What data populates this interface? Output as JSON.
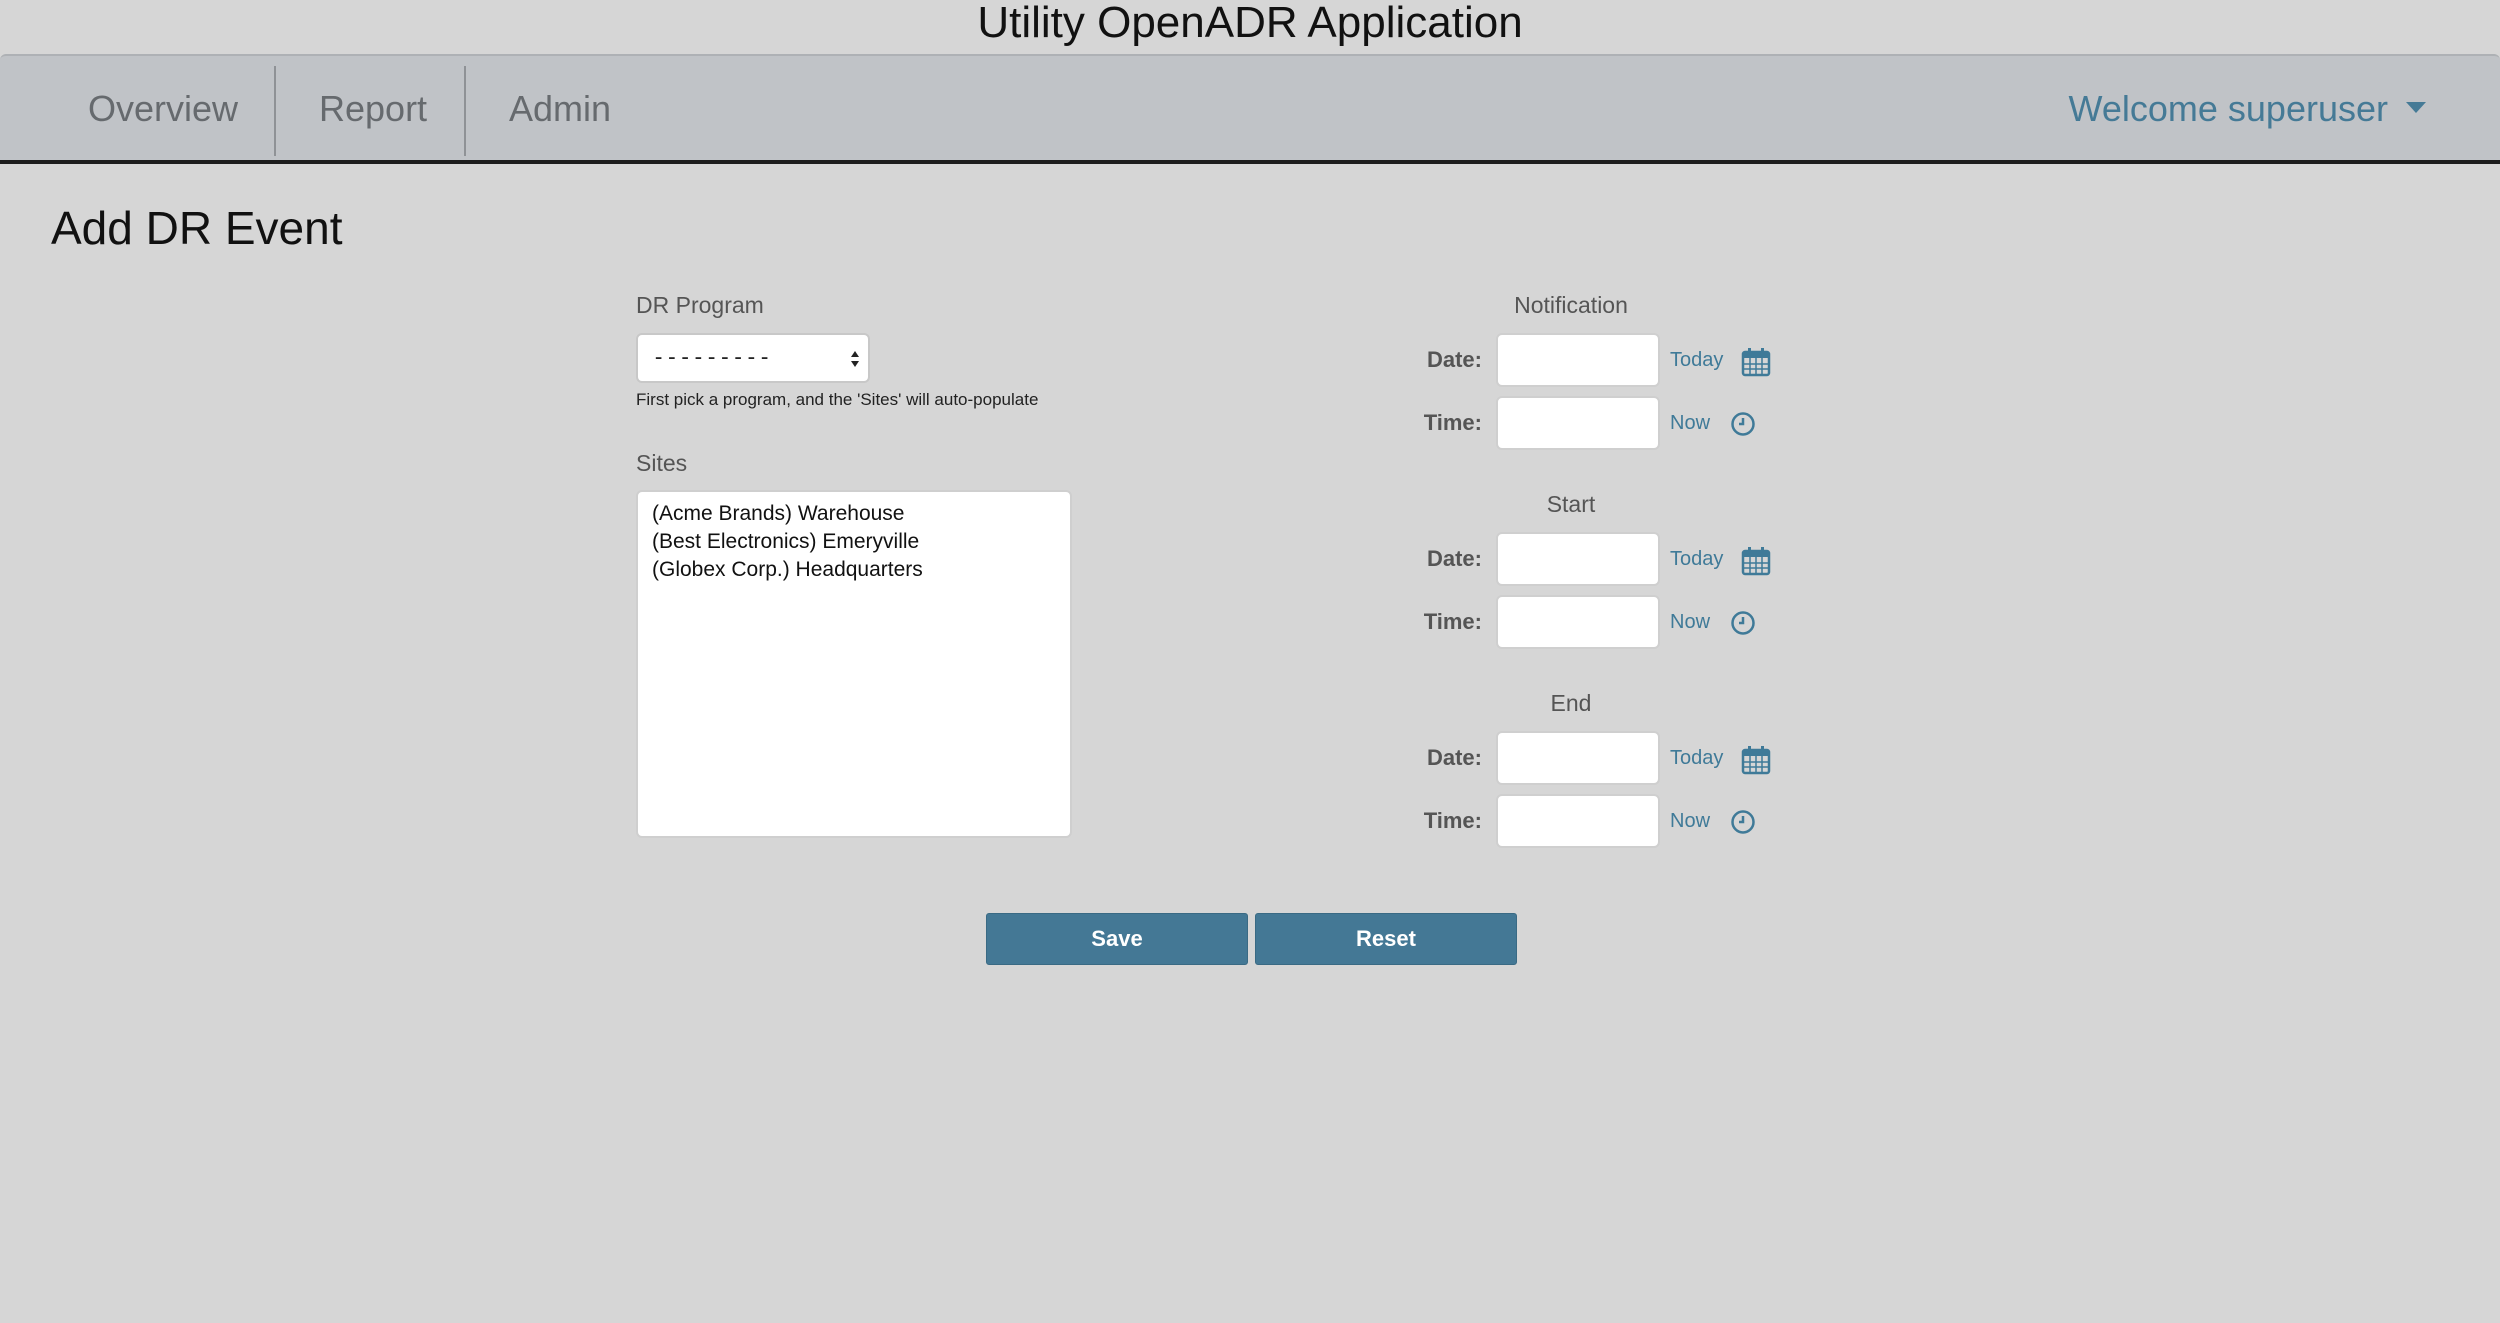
{
  "app": {
    "title": "Utility OpenADR Application"
  },
  "nav": {
    "items": [
      {
        "label": "Overview"
      },
      {
        "label": "Report"
      },
      {
        "label": "Admin"
      }
    ],
    "user_menu": "Welcome superuser"
  },
  "page": {
    "title": "Add DR Event"
  },
  "form": {
    "program_label": "DR Program",
    "program_value": "---------",
    "program_help": "First pick a program, and the 'Sites' will auto-populate",
    "sites_label": "Sites",
    "sites": [
      "(Acme Brands) Warehouse",
      "(Best Electronics) Emeryville",
      "(Globex Corp.) Headquarters"
    ],
    "schedule": [
      {
        "title": "Notification",
        "date_label": "Date:",
        "time_label": "Time:",
        "date_value": "",
        "time_value": "",
        "today_label": "Today",
        "now_label": "Now"
      },
      {
        "title": "Start",
        "date_label": "Date:",
        "time_label": "Time:",
        "date_value": "",
        "time_value": "",
        "today_label": "Today",
        "now_label": "Now"
      },
      {
        "title": "End",
        "date_label": "Date:",
        "time_label": "Time:",
        "date_value": "",
        "time_value": "",
        "today_label": "Today",
        "now_label": "Now"
      }
    ],
    "icons": {
      "date_picker": "calendar-icon",
      "time_picker": "clock-icon"
    },
    "save_label": "Save",
    "reset_label": "Reset"
  },
  "colors": {
    "background": "#d6d6d6",
    "navbar": "#c0c3c7",
    "accent": "#447895",
    "link": "#3f7a98"
  }
}
